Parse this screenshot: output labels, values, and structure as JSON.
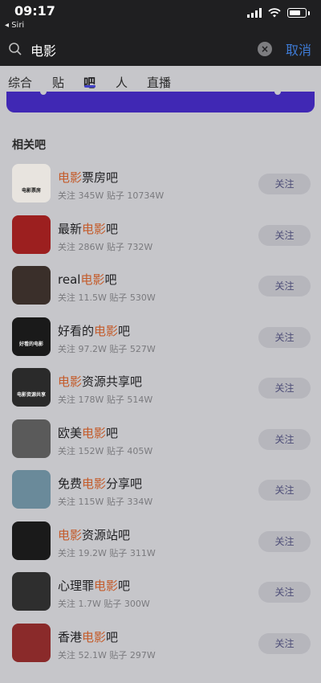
{
  "status": {
    "time": "09:17",
    "back_label": "◂ Siri"
  },
  "search": {
    "query": "电影",
    "cancel_label": "取消"
  },
  "tabs": [
    {
      "label": "综合",
      "active": false
    },
    {
      "label": "贴",
      "active": false
    },
    {
      "label": "吧",
      "active": true
    },
    {
      "label": "人",
      "active": false
    },
    {
      "label": "直播",
      "active": false
    }
  ],
  "section": {
    "title": "相关吧"
  },
  "rows": [
    {
      "pre": "",
      "hl": "电影",
      "post": "票房吧",
      "follow": "关注",
      "stats_follow": "关注 345W",
      "stats_posts": "贴子 10734W",
      "avatar_color": "#e8e4df",
      "avatar_text": "电影票房"
    },
    {
      "pre": "最新",
      "hl": "电影",
      "post": "吧",
      "follow": "关注",
      "stats_follow": "关注 286W",
      "stats_posts": "贴子 732W",
      "avatar_color": "#9c1f1f",
      "avatar_text": ""
    },
    {
      "pre": "real",
      "hl": "电影",
      "post": "吧",
      "follow": "关注",
      "stats_follow": "关注 11.5W",
      "stats_posts": "贴子 530W",
      "avatar_color": "#3a2f2a",
      "avatar_text": ""
    },
    {
      "pre": "好看的",
      "hl": "电影",
      "post": "吧",
      "follow": "关注",
      "stats_follow": "关注 97.2W",
      "stats_posts": "贴子 527W",
      "avatar_color": "#1a1a1a",
      "avatar_text": "好看的电影"
    },
    {
      "pre": "",
      "hl": "电影",
      "post": "资源共享吧",
      "follow": "关注",
      "stats_follow": "关注 178W",
      "stats_posts": "贴子 514W",
      "avatar_color": "#2a2a2a",
      "avatar_text": "电影资源共享"
    },
    {
      "pre": "欧美",
      "hl": "电影",
      "post": "吧",
      "follow": "关注",
      "stats_follow": "关注 152W",
      "stats_posts": "贴子 405W",
      "avatar_color": "#5a5a5a",
      "avatar_text": ""
    },
    {
      "pre": "免费",
      "hl": "电影",
      "post": "分享吧",
      "follow": "关注",
      "stats_follow": "关注 115W",
      "stats_posts": "贴子 334W",
      "avatar_color": "#6a8a9a",
      "avatar_text": ""
    },
    {
      "pre": "",
      "hl": "电影",
      "post": "资源站吧",
      "follow": "关注",
      "stats_follow": "关注 19.2W",
      "stats_posts": "贴子 311W",
      "avatar_color": "#1a1a1a",
      "avatar_text": ""
    },
    {
      "pre": "心理罪",
      "hl": "电影",
      "post": "吧",
      "follow": "关注",
      "stats_follow": "关注 1.7W",
      "stats_posts": "贴子 300W",
      "avatar_color": "#2e2e2e",
      "avatar_text": ""
    },
    {
      "pre": "香港",
      "hl": "电影",
      "post": "吧",
      "follow": "关注",
      "stats_follow": "关注 52.1W",
      "stats_posts": "贴子 297W",
      "avatar_color": "#8a2a2a",
      "avatar_text": ""
    }
  ]
}
